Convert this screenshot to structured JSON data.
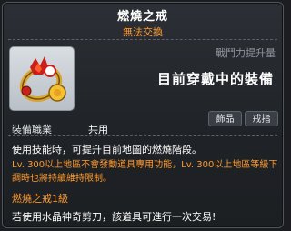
{
  "tooltip": {
    "item_name": "燃燒之戒",
    "trade_status": "無法交換",
    "icon": "flame-ring-icon",
    "power_label": "戰鬥力提升量",
    "power_text": "目前穿戴中的裝備",
    "tags": [
      "飾品",
      "戒指"
    ],
    "job_label": "裝備職業",
    "job_value": "共用",
    "description": "使用技能時，可提升目前地圖的燃燒階段。",
    "description_orange": "Lv. 300以上地區不會發動道具專用功能，Lv. 300以上地區等級下調時也將持續維持限制。",
    "level_text": "燃燒之戒1級",
    "scissors_text": "若使用水晶神奇剪刀，該道具可進行一次交易!",
    "colors": {
      "orange": "#ff9a2e",
      "white": "#ffffff",
      "gray": "#8f959c",
      "background": "#1f2226"
    }
  }
}
